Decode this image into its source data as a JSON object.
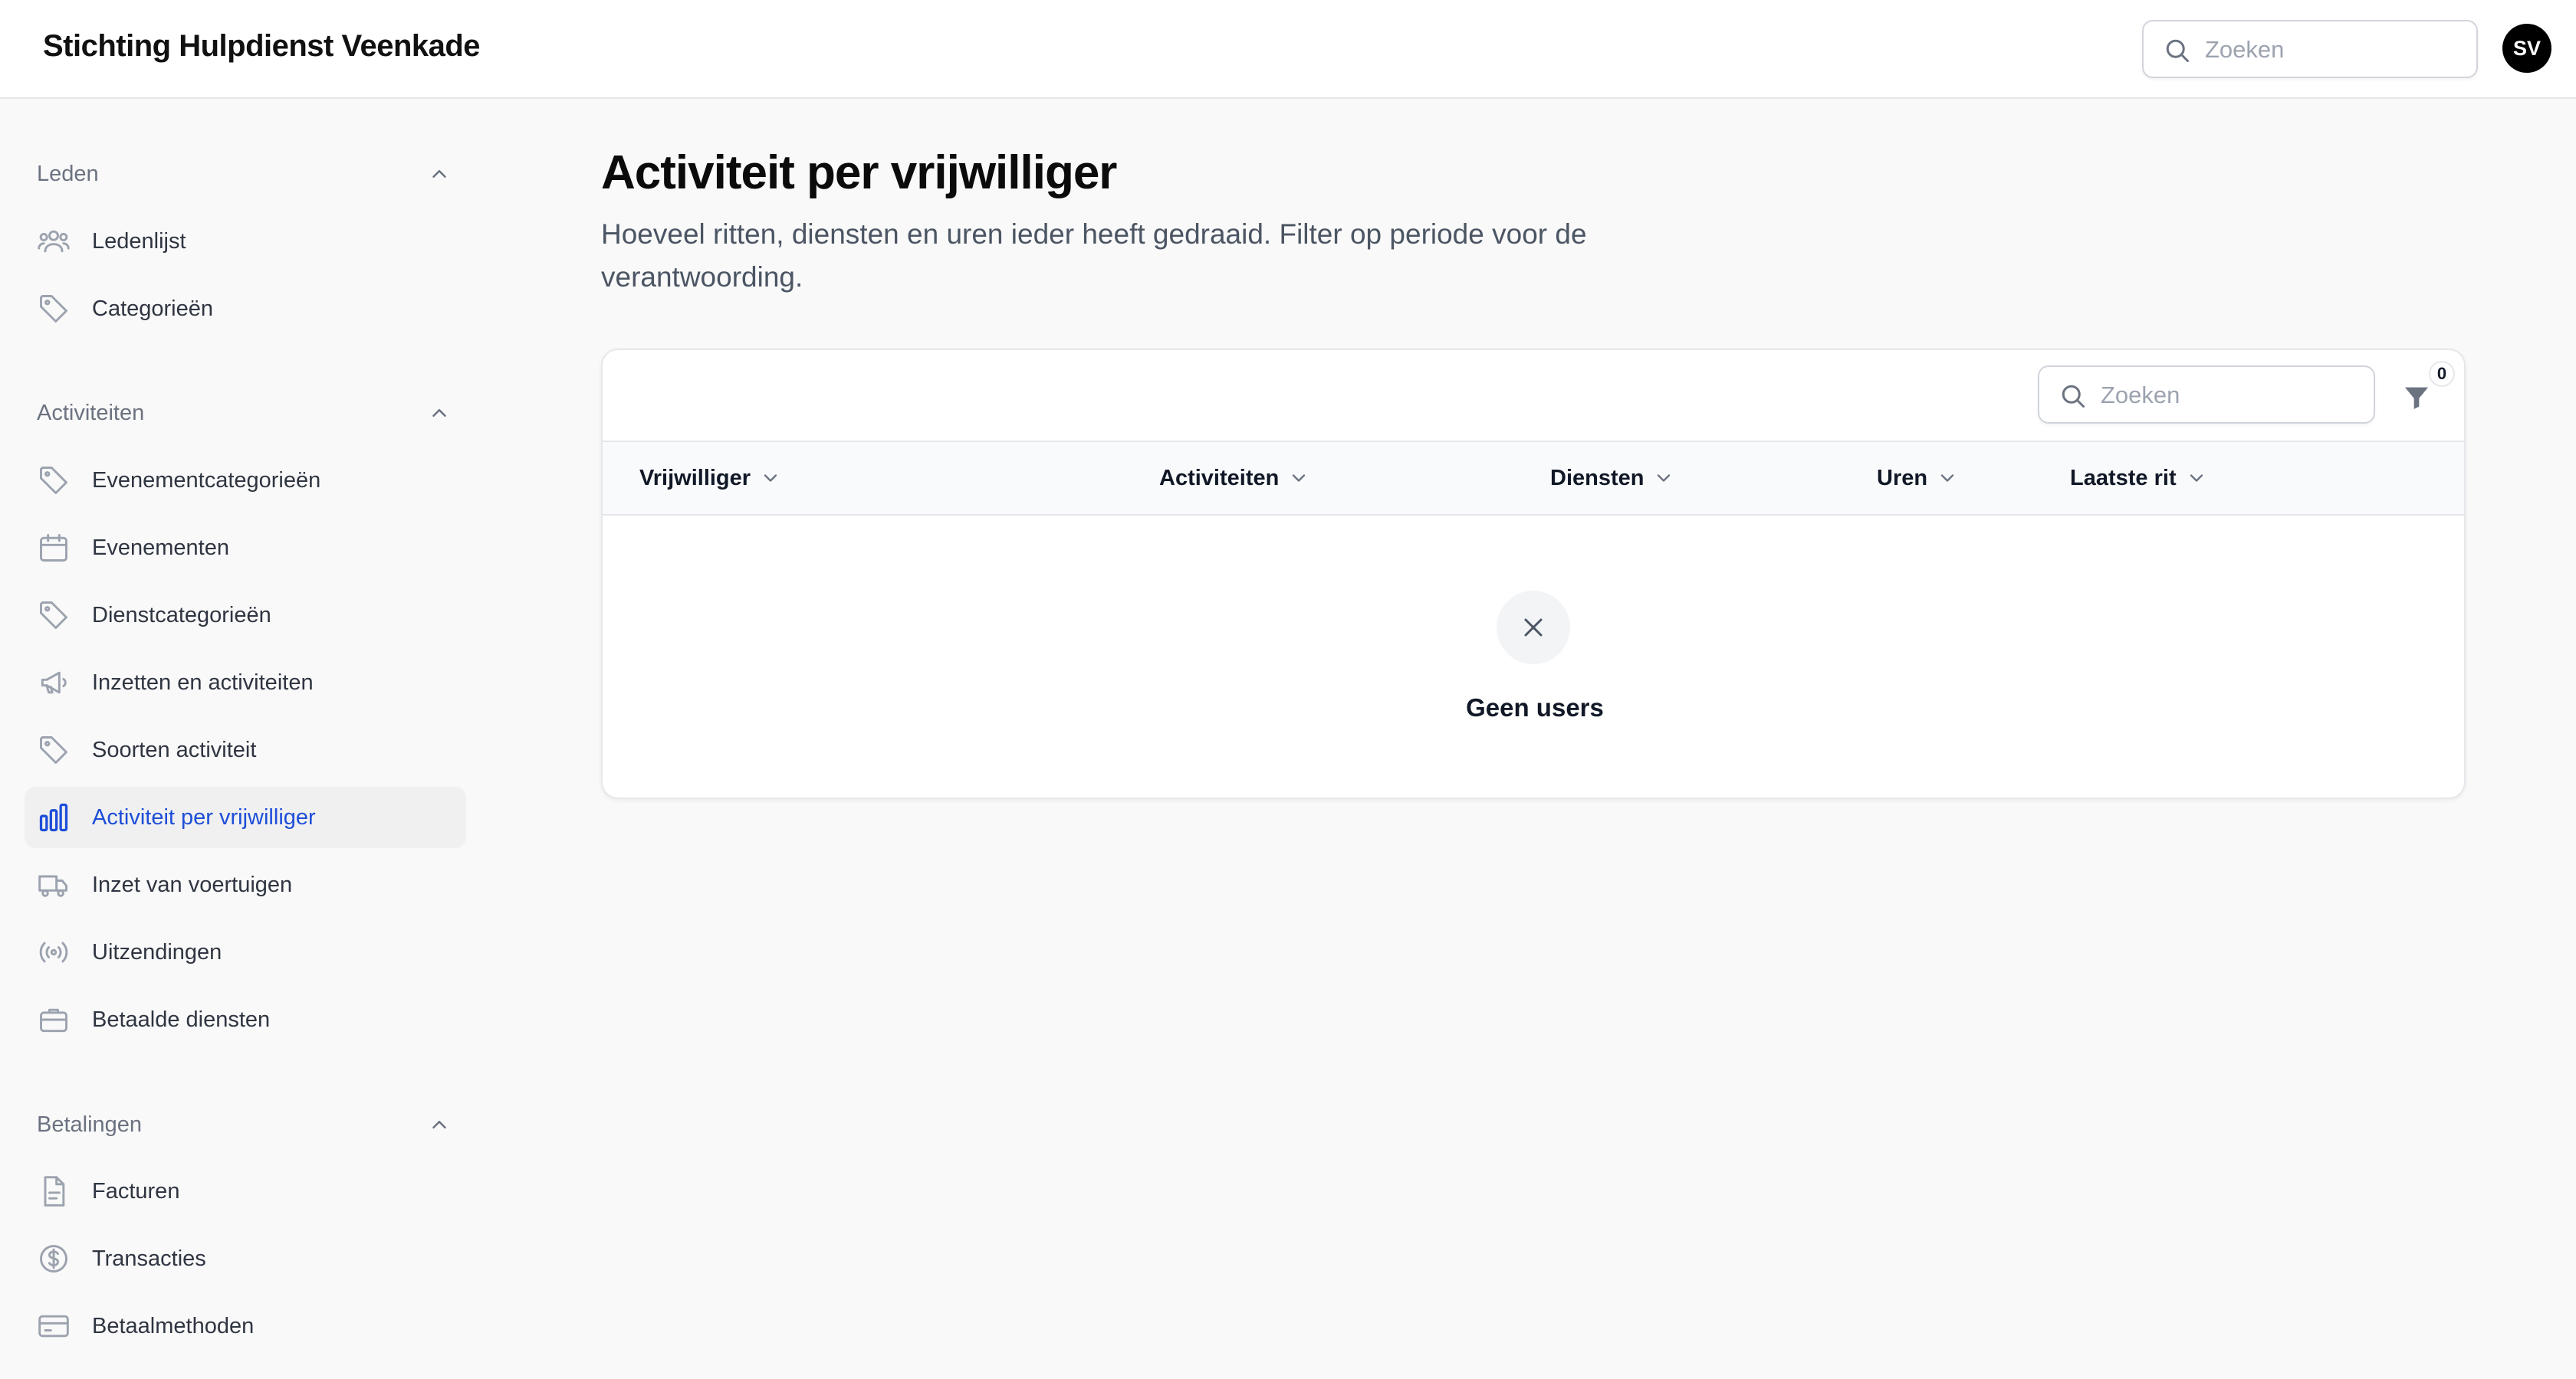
{
  "header": {
    "brand": "Stichting Hulpdienst Veenkade",
    "search_placeholder": "Zoeken",
    "avatar_initials": "SV"
  },
  "sidebar": {
    "groups": [
      {
        "label": "Leden",
        "items": [
          {
            "label": "Ledenlijst",
            "icon": "users-icon"
          },
          {
            "label": "Categorieën",
            "icon": "tag-icon"
          }
        ]
      },
      {
        "label": "Activiteiten",
        "items": [
          {
            "label": "Evenementcategorieën",
            "icon": "tag-icon"
          },
          {
            "label": "Evenementen",
            "icon": "calendar-icon"
          },
          {
            "label": "Dienstcategorieën",
            "icon": "tag-icon"
          },
          {
            "label": "Inzetten en activiteiten",
            "icon": "megaphone-icon"
          },
          {
            "label": "Soorten activiteit",
            "icon": "tag-icon"
          },
          {
            "label": "Activiteit per vrijwilliger",
            "icon": "bar-chart-icon",
            "active": true
          },
          {
            "label": "Inzet van voertuigen",
            "icon": "truck-icon"
          },
          {
            "label": "Uitzendingen",
            "icon": "broadcast-icon"
          },
          {
            "label": "Betaalde diensten",
            "icon": "briefcase-icon"
          }
        ]
      },
      {
        "label": "Betalingen",
        "items": [
          {
            "label": "Facturen",
            "icon": "document-icon"
          },
          {
            "label": "Transacties",
            "icon": "dollar-circle-icon"
          },
          {
            "label": "Betaalmethoden",
            "icon": "credit-card-icon"
          }
        ]
      }
    ]
  },
  "main": {
    "title": "Activiteit per vrijwilliger",
    "description": "Hoeveel ritten, diensten en uren ieder heeft gedraaid. Filter op periode voor de verantwoording.",
    "table": {
      "search_placeholder": "Zoeken",
      "filter_count": "0",
      "columns": [
        "Vrijwilliger",
        "Activiteiten",
        "Diensten",
        "Uren",
        "Laatste rit"
      ],
      "empty_text": "Geen users"
    }
  },
  "colors": {
    "accent": "#1d4ed8",
    "active_bg": "#f0f0f0",
    "page_bg": "#f9f9f9"
  }
}
